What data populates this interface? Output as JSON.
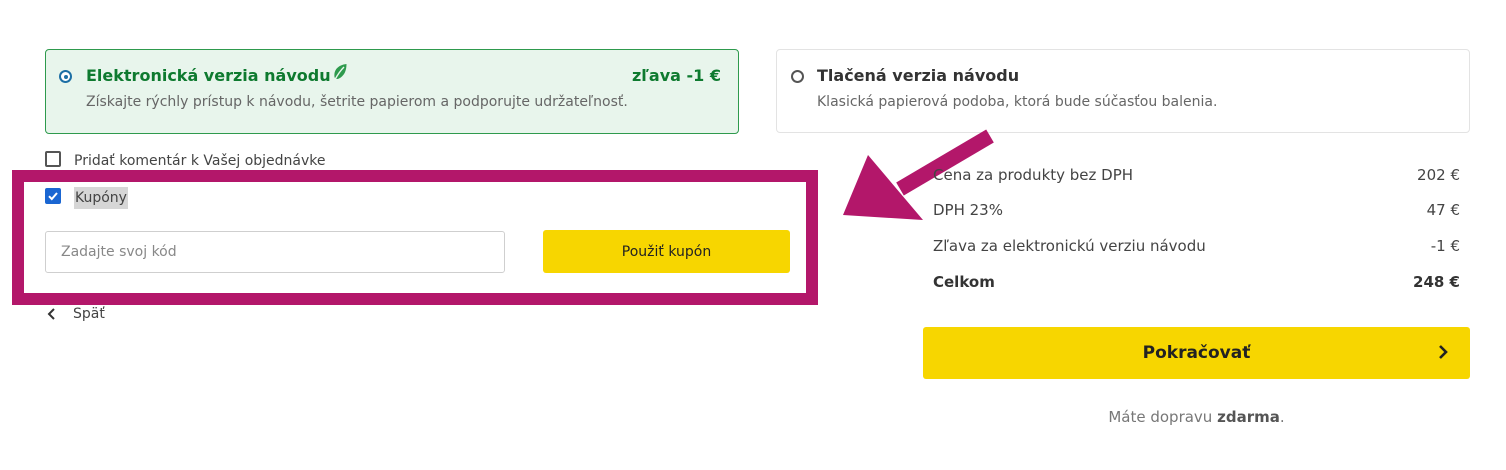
{
  "manual_options": {
    "electronic": {
      "title": "Elektronická verzia návodu",
      "description": "Získajte rýchly prístup k návodu, šetrite papierom a podporujte udržateľnosť.",
      "discount": "zľava -1 €",
      "selected": true,
      "icon": "leaf-icon"
    },
    "printed": {
      "title": "Tlačená verzia návodu",
      "description": "Klasická papierová podoba, ktorá bude súčasťou balenia.",
      "selected": false
    }
  },
  "comment": {
    "label": "Pridať komentár k Vašej objednávke",
    "checked": false
  },
  "coupons": {
    "label": "Kupóny",
    "checked": true,
    "input_placeholder": "Zadajte svoj kód",
    "input_value": "",
    "apply_label": "Použiť kupón"
  },
  "back": {
    "label": "Späť"
  },
  "summary": {
    "rows": [
      {
        "label": "Cena za produkty bez DPH",
        "value": "202 €"
      },
      {
        "label": "DPH 23%",
        "value": "47 €"
      },
      {
        "label": "Zľava za elektronickú verziu návodu",
        "value": "-1 €"
      }
    ],
    "total": {
      "label": "Celkom",
      "value": "248 €"
    }
  },
  "continue": {
    "label": "Pokračovať"
  },
  "shipping": {
    "prefix": "Máte dopravu",
    "emphasis": "zdarma",
    "suffix": "."
  },
  "colors": {
    "accent_yellow": "#f7d600",
    "selected_green": "#0e7a2f",
    "selected_bg": "#e8f5ec",
    "annotation_magenta": "#b3176a",
    "checkbox_blue": "#1a66d2"
  }
}
